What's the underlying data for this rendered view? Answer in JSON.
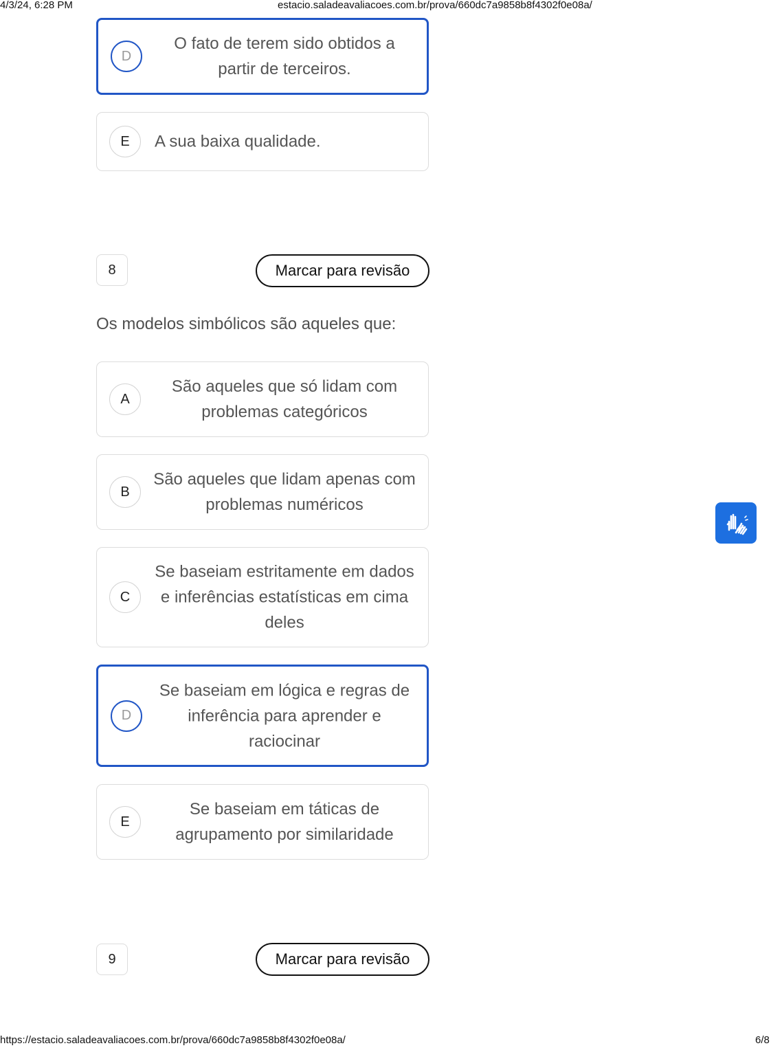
{
  "print_header": {
    "datetime": "4/3/24, 6:28 PM",
    "url": "estacio.saladeavaliacoes.com.br/prova/660dc7a9858b8f4302f0e08a/"
  },
  "print_footer": {
    "url": "https://estacio.saladeavaliacoes.com.br/prova/660dc7a9858b8f4302f0e08a/",
    "page": "6/8"
  },
  "prev_question": {
    "options": [
      {
        "letter": "D",
        "text": "O fato de terem sido obtidos a partir de terceiros.",
        "selected": true
      },
      {
        "letter": "E",
        "text": "A sua baixa qualidade.",
        "selected": false
      }
    ]
  },
  "question8": {
    "number": "8",
    "mark_label": "Marcar para revisão",
    "prompt": "Os modelos simbólicos são aqueles que:",
    "options": [
      {
        "letter": "A",
        "text": "São aqueles que só lidam com problemas categóricos",
        "selected": false
      },
      {
        "letter": "B",
        "text": "São aqueles que lidam apenas com problemas numéricos",
        "selected": false
      },
      {
        "letter": "C",
        "text": "Se baseiam estritamente em dados e inferências estatísticas em cima deles",
        "selected": false
      },
      {
        "letter": "D",
        "text": "Se baseiam em lógica e regras de inferência para aprender e raciocinar",
        "selected": true
      },
      {
        "letter": "E",
        "text": "Se baseiam em táticas de agrupamento por similaridade",
        "selected": false
      }
    ]
  },
  "question9": {
    "number": "9",
    "mark_label": "Marcar para revisão"
  },
  "accessibility_widget": {
    "icon": "sign-language-hands-icon",
    "color": "#1d6fe0"
  },
  "colors": {
    "selected_border": "#2156c6",
    "option_border": "#dcdcdc"
  }
}
